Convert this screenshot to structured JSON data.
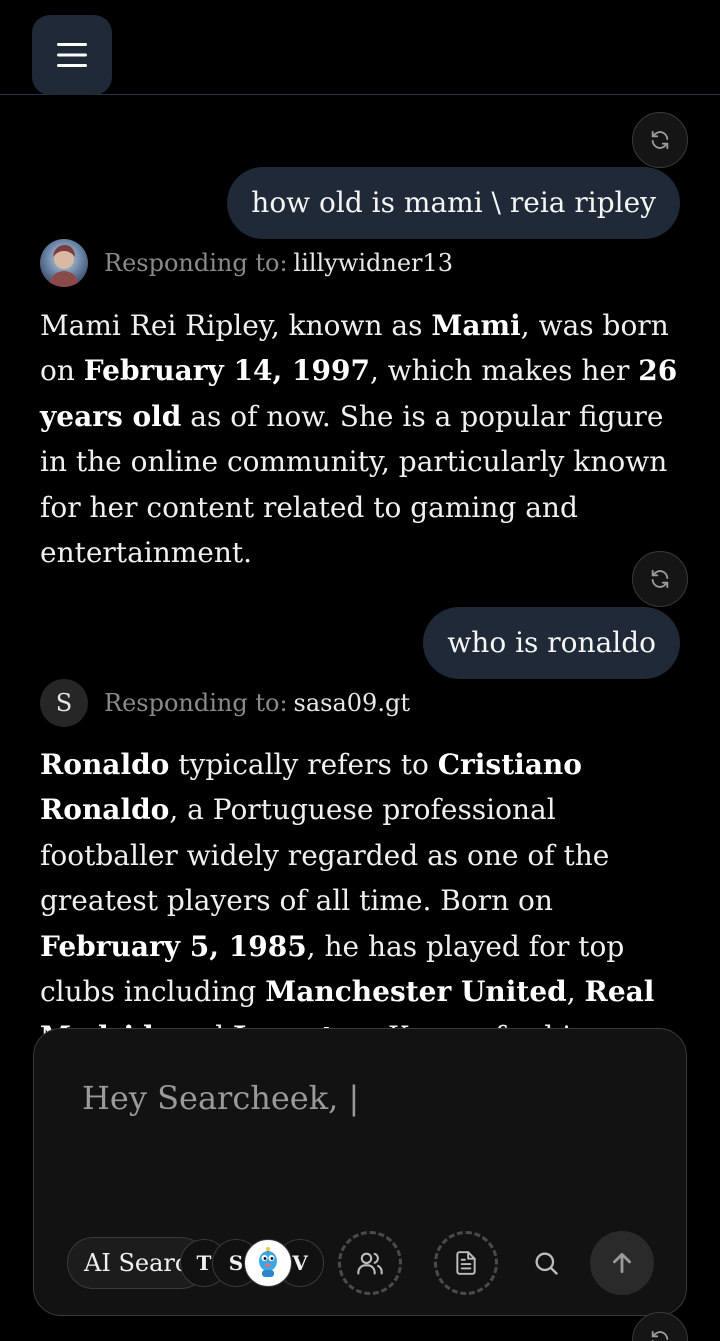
{
  "header": {
    "menu_icon": "hamburger-menu-icon"
  },
  "messages": [
    {
      "question": "how old is mami \\ reia ripley",
      "responding_label": "Responding to:",
      "responding_user": "lillywidner13",
      "answer": [
        {
          "t": "Mami Rei Ripley, known as "
        },
        {
          "t": "Mami",
          "b": true
        },
        {
          "t": ", was born on "
        },
        {
          "t": "February 14, 1997",
          "b": true
        },
        {
          "t": ", which makes her "
        },
        {
          "t": "26 years old",
          "b": true
        },
        {
          "t": " as of now. She is a popular figure in the online community, particularly known for her content related to gaming and entertainment."
        }
      ]
    },
    {
      "question": "who is ronaldo",
      "responding_label": "Responding to:",
      "responding_user": "sasa09.gt",
      "avatar_letter": "S",
      "answer": [
        {
          "t": "Ronaldo",
          "b": true
        },
        {
          "t": " typically refers to "
        },
        {
          "t": "Cristiano Ronaldo",
          "b": true
        },
        {
          "t": ", a Portuguese professional footballer widely regarded as one of the greatest players of all time. Born on "
        },
        {
          "t": "February 5, 1985",
          "b": true
        },
        {
          "t": ", he has played for top clubs including "
        },
        {
          "t": "Manchester United",
          "b": true
        },
        {
          "t": ", "
        },
        {
          "t": "Real Madrid",
          "b": true
        },
        {
          "t": ", and "
        },
        {
          "t": "Juventus",
          "b": true
        },
        {
          "t": ". Known for his incredible"
        }
      ]
    }
  ],
  "composer": {
    "placeholder": "Hey Searcheek, ",
    "caret": "|",
    "mode_label": "AI Search",
    "bots": [
      "T",
      "S",
      "V"
    ],
    "colors": {
      "accent": "#1f2937",
      "background": "#000000",
      "panel": "#121212"
    }
  }
}
